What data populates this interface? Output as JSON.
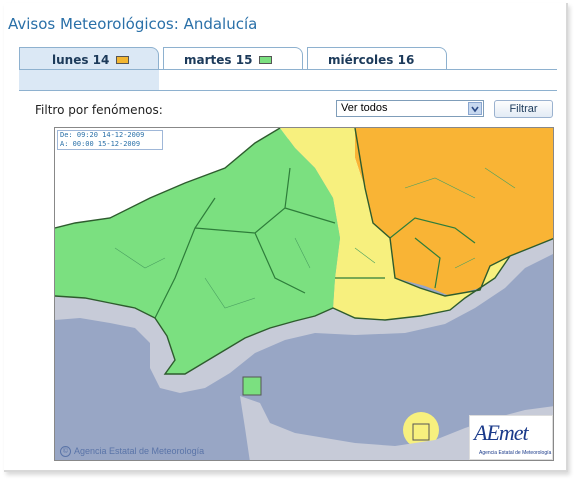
{
  "page": {
    "title": "Avisos Meteorológicos: Andalucía"
  },
  "tabs": [
    {
      "label": "lunes 14",
      "level": "amarillo",
      "color": "#f2b632",
      "active": true
    },
    {
      "label": "martes 15",
      "level": "verde",
      "color": "#7be080",
      "active": false
    },
    {
      "label": "miércoles 16",
      "level": "",
      "color": "",
      "active": false
    }
  ],
  "filter": {
    "label": "Filtro por fenómenos:",
    "selected": "Ver todos",
    "button": "Filtrar"
  },
  "map": {
    "valid_from": "De: 09:20 14-12-2009",
    "valid_to": "A:  00:00 15-12-2009",
    "copyright": "Agencia Estatal de Meteorología",
    "copyright_symbol": "©",
    "logo_text": "AEmet",
    "logo_subtitle": "Agencia Estatal de Meteorología",
    "colors": {
      "green": "#7be080",
      "yellow": "#f7f07e",
      "orange": "#f9b435",
      "sea": "#98a6c5",
      "coast_buffer": "#c7cbd8",
      "land_outside": "#ffffff"
    }
  }
}
